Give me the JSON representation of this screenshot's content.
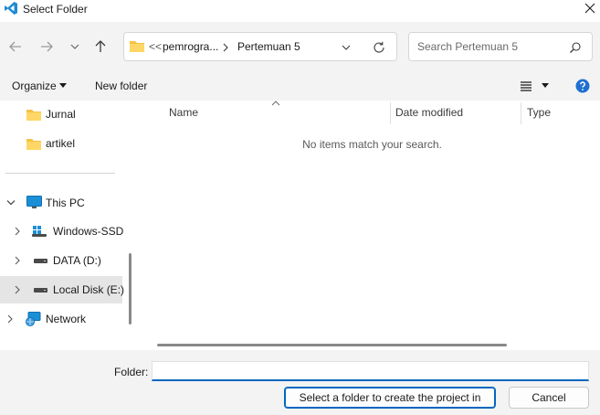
{
  "window": {
    "title": "Select Folder"
  },
  "address": {
    "overflow": "<<",
    "crumbs": [
      "pemrogra...",
      "Pertemuan 5"
    ]
  },
  "search": {
    "placeholder": "Search Pertemuan 5"
  },
  "toolbar": {
    "organize": "Organize",
    "new_folder": "New folder"
  },
  "sidebar": {
    "items": [
      {
        "label": "Jurnal",
        "icon": "folder-icon"
      },
      {
        "label": "artikel",
        "icon": "folder-icon"
      },
      {
        "label": "This PC",
        "icon": "pc-icon"
      },
      {
        "label": "Windows-SSD",
        "icon": "drive-icon"
      },
      {
        "label": "DATA (D:)",
        "icon": "drive-icon"
      },
      {
        "label": "Local Disk (E:)",
        "icon": "drive-icon",
        "selected": true
      },
      {
        "label": "Network",
        "icon": "network-icon"
      }
    ]
  },
  "columns": {
    "name": "Name",
    "date_modified": "Date modified",
    "type": "Type"
  },
  "empty_message": "No items match your search.",
  "footer": {
    "folder_label": "Folder:",
    "folder_value": "",
    "primary_button": "Select a folder to create the project in",
    "cancel_button": "Cancel"
  },
  "colors": {
    "accent": "#0067c0",
    "folder": "#f5c242",
    "selection": "#e5e5e5"
  }
}
